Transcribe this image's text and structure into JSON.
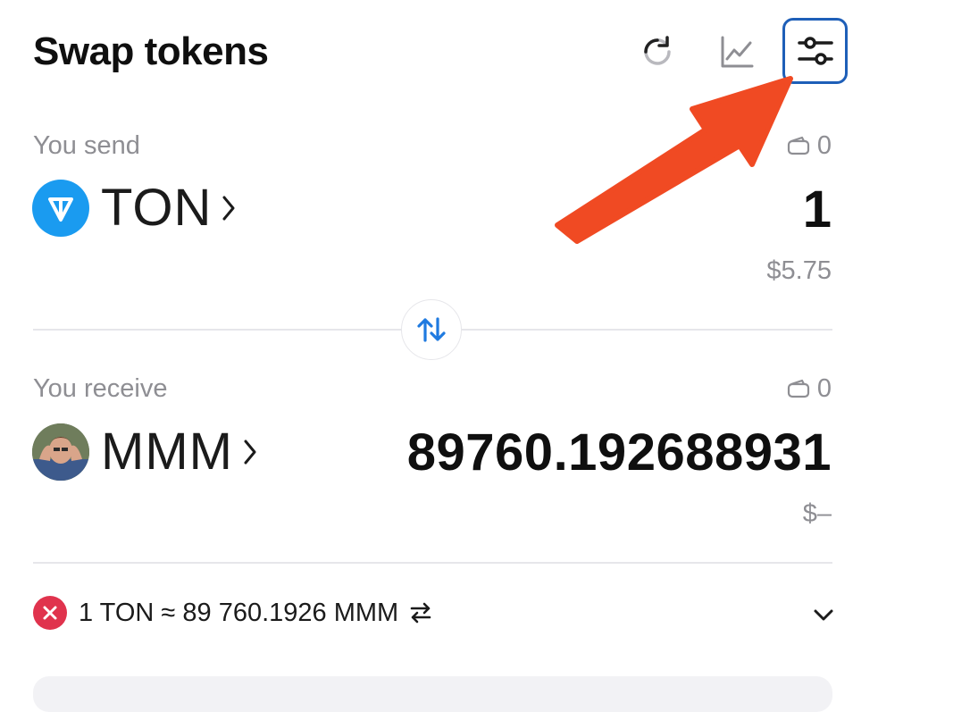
{
  "header": {
    "title": "Swap tokens",
    "refresh_icon": "refresh-icon",
    "chart_icon": "chart-icon",
    "settings_icon": "sliders-icon"
  },
  "send": {
    "label": "You send",
    "balance": "0",
    "token": "TON",
    "amount": "1",
    "usd": "$5.75"
  },
  "receive": {
    "label": "You receive",
    "balance": "0",
    "token": "MMM",
    "amount": "89760.192688931",
    "usd": "$–"
  },
  "rate": {
    "text": "1 TON ≈ 89 760.1926 MMM",
    "status_icon": "error-icon",
    "status_color": "#e0334d"
  },
  "colors": {
    "accent": "#1e5fb8",
    "arrow_annotation": "#f04a23",
    "ton_blue": "#1a9bf0",
    "swap_blue": "#1f7ae0"
  }
}
